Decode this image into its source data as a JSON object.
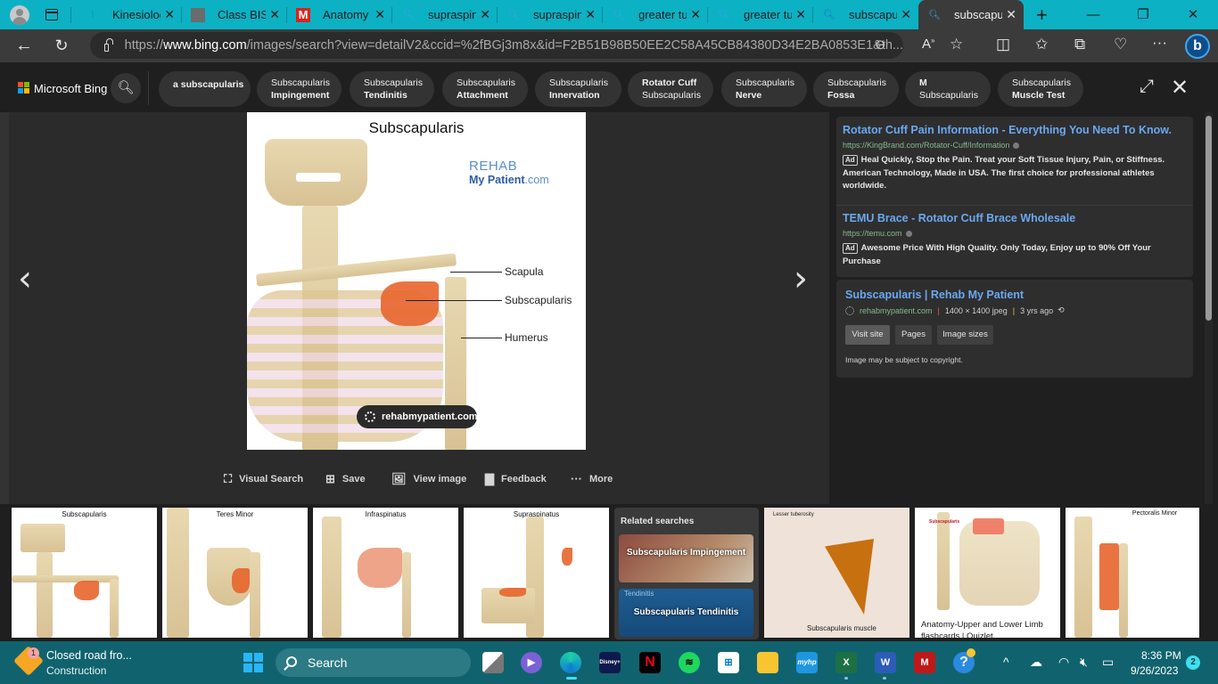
{
  "browser": {
    "tabs": [
      {
        "title": "Kinesiolog",
        "icon": "kinesiology-favicon"
      },
      {
        "title": "Class BISC",
        "icon": "mcgraw-hill-favicon"
      },
      {
        "title": "Anatomy &",
        "icon": "m-favicon"
      },
      {
        "title": "supraspina",
        "icon": "bing-search-favicon"
      },
      {
        "title": "supraspina",
        "icon": "bing-search-favicon"
      },
      {
        "title": "greater tul",
        "icon": "bing-search-favicon"
      },
      {
        "title": "greater tul",
        "icon": "bing-search-favicon"
      },
      {
        "title": "subscapul",
        "icon": "bing-search-favicon"
      },
      {
        "title": "subscapul",
        "icon": "bing-search-favicon",
        "active": true
      }
    ],
    "url_prefix": "https://",
    "url_domain": "www.bing.com",
    "url_rest": "/images/search?view=detailV2&ccid=%2fBGj3m8x&id=F2B51B98B50EE2C58A45CB84380D34E2BA0853E1&th..."
  },
  "bing": {
    "brand": "Microsoft Bing",
    "chips": [
      {
        "line1": "a subscapularis",
        "line2": ""
      },
      {
        "line1": "Subscapularis",
        "line2": "Impingement"
      },
      {
        "line1": "Subscapularis",
        "line2": "Tendinitis"
      },
      {
        "line1": "Subscapularis",
        "line2": "Attachment"
      },
      {
        "line1": "Subscapularis",
        "line2": "Innervation"
      },
      {
        "line1": "Rotator Cuff",
        "line2": "Subscapularis",
        "bold_first": true
      },
      {
        "line1": "Subscapularis",
        "line2": "Nerve"
      },
      {
        "line1": "Subscapularis",
        "line2": "Fossa"
      },
      {
        "line1": "M",
        "line2": "Subscapularis",
        "bold_first": true
      },
      {
        "line1": "Subscapularis",
        "line2": "Muscle Test"
      }
    ]
  },
  "viewer": {
    "image_title": "Subscapularis",
    "watermark_line1": "REHAB",
    "watermark_line2a": "My Patient",
    "watermark_line2b": ".com",
    "labels": [
      "Scapula",
      "Subscapularis",
      "Humerus"
    ],
    "source_pill": "rehabmypatient.com",
    "actions": [
      {
        "label": "Visual Search",
        "icon": "visual-search-icon"
      },
      {
        "label": "Save",
        "icon": "save-icon"
      },
      {
        "label": "View image",
        "icon": "view-image-icon"
      },
      {
        "label": "Feedback",
        "icon": "feedback-icon"
      },
      {
        "label": "More",
        "icon": "more-icon"
      }
    ]
  },
  "ads": [
    {
      "title": "Rotator Cuff Pain Information - Everything You Need To Know.",
      "url": "https://KingBrand.com/Rotator-Cuff/Information",
      "tag": "Ad",
      "desc": "Heal Quickly, Stop the Pain. Treat your Soft Tissue Injury, Pain, or Stiffness. American Technology, Made in USA. The first choice for professional athletes worldwide."
    },
    {
      "title": "TEMU Brace - Rotator Cuff Brace Wholesale",
      "url": "https://temu.com",
      "tag": "Ad",
      "desc": "Awesome Price With High Quality. Only Today, Enjoy up to 90% Off Your Purchase"
    }
  ],
  "info": {
    "title": "Subscapularis | Rehab My Patient",
    "domain": "rehabmypatient.com",
    "dimensions": "1400 × 1400 jpeg",
    "age": "3 yrs ago",
    "buttons": [
      "Visit site",
      "Pages",
      "Image sizes"
    ],
    "copyright": "Image may be subject to copyright."
  },
  "strip": {
    "thumbs": [
      {
        "caption": "Subscapularis"
      },
      {
        "caption": "Teres Minor"
      },
      {
        "caption": "Infraspinatus"
      },
      {
        "caption": "Supraspinatus"
      }
    ],
    "related_heading": "Related searches",
    "related": [
      {
        "label": "Subscapularis Impingement",
        "overlay": ""
      },
      {
        "label": "Subscapularis Tendinitis",
        "overlay": "Tendinitis"
      }
    ],
    "lesser_tuberosity_label": "Lesser tuberosity",
    "subscap_muscle_caption": "Subscapularis muscle",
    "quizlet_caption": "Anatomy-Upper and Lower Limb flashcards | Quizlet",
    "pectoralis_caption": "Pectoralis Minor"
  },
  "taskbar": {
    "weather_line1": "Closed road fro...",
    "weather_line2": "Construction",
    "weather_badge": "1",
    "search_label": "Search",
    "time": "8:36 PM",
    "date": "9/26/2023",
    "notification_count": "2"
  }
}
